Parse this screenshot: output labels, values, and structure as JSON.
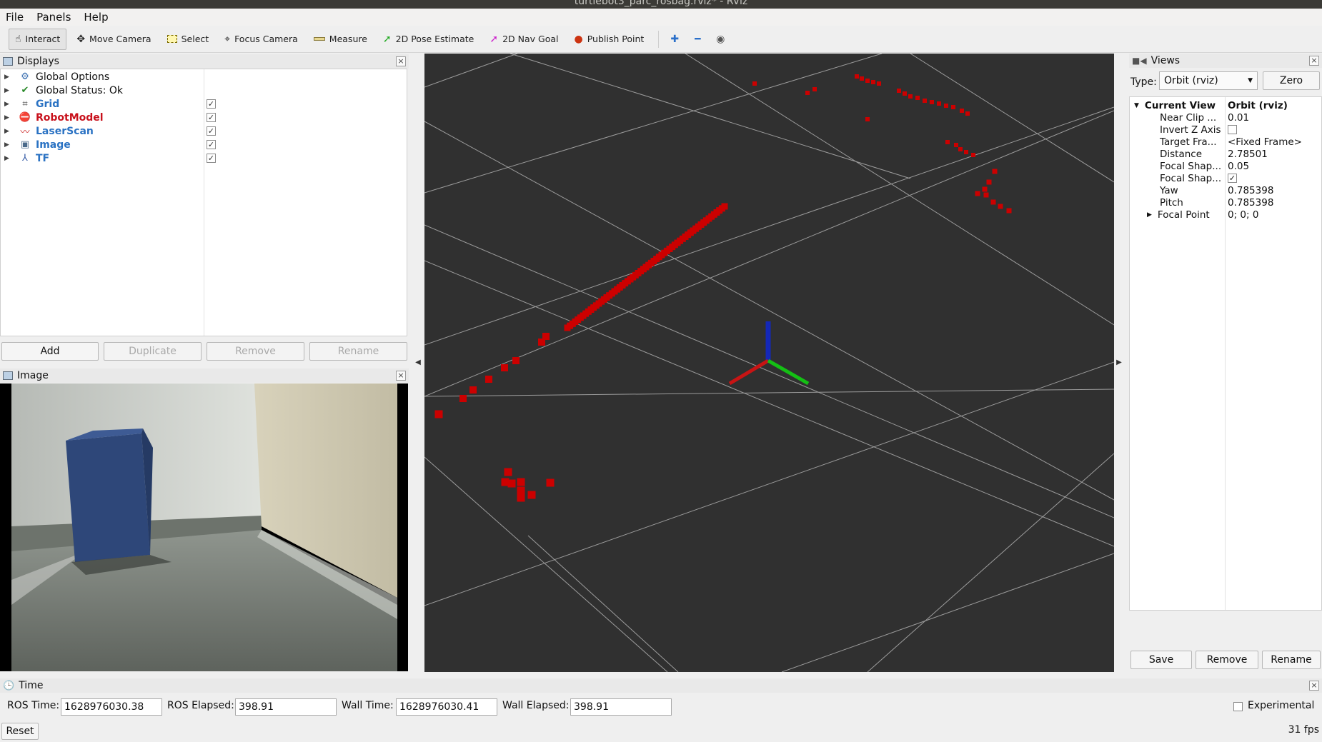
{
  "window": {
    "title": "turtlebot3_parc_rosbag.rviz* - RViz"
  },
  "menu": [
    "File",
    "Panels",
    "Help"
  ],
  "toolbar": {
    "interact": "Interact",
    "move_camera": "Move Camera",
    "select": "Select",
    "focus_camera": "Focus Camera",
    "measure": "Measure",
    "pose_estimate": "2D Pose Estimate",
    "nav_goal": "2D Nav Goal",
    "publish_point": "Publish Point"
  },
  "displays": {
    "title": "Displays",
    "items": [
      {
        "label": "Global Options",
        "icon": "gear-icon",
        "style": "normal",
        "checked": null
      },
      {
        "label": "Global Status: Ok",
        "icon": "check-icon",
        "style": "normal",
        "checked": null
      },
      {
        "label": "Grid",
        "icon": "grid-icon",
        "style": "blue",
        "checked": true
      },
      {
        "label": "RobotModel",
        "icon": "error-icon",
        "style": "red",
        "checked": true
      },
      {
        "label": "LaserScan",
        "icon": "laser-icon",
        "style": "blue",
        "checked": true
      },
      {
        "label": "Image",
        "icon": "image-icon",
        "style": "blue",
        "checked": true
      },
      {
        "label": "TF",
        "icon": "axes-icon",
        "style": "blue",
        "checked": true
      }
    ],
    "buttons": {
      "add": "Add",
      "duplicate": "Duplicate",
      "remove": "Remove",
      "rename": "Rename"
    }
  },
  "image_panel": {
    "title": "Image"
  },
  "views": {
    "title": "Views",
    "type_label": "Type:",
    "type_value": "Orbit (rviz)",
    "zero": "Zero",
    "header": {
      "name": "Current View",
      "value": "Orbit (rviz)"
    },
    "properties": [
      {
        "name": "Near Clip ...",
        "value": "0.01"
      },
      {
        "name": "Invert Z Axis",
        "value": "",
        "checkbox": false
      },
      {
        "name": "Target Fra...",
        "value": "<Fixed Frame>"
      },
      {
        "name": "Distance",
        "value": "2.78501"
      },
      {
        "name": "Focal Shap...",
        "value": "0.05"
      },
      {
        "name": "Focal Shap...",
        "value": "",
        "checkbox": true
      },
      {
        "name": "Yaw",
        "value": "0.785398"
      },
      {
        "name": "Pitch",
        "value": "0.785398"
      },
      {
        "name": "Focal Point",
        "value": "0; 0; 0"
      }
    ],
    "buttons": {
      "save": "Save",
      "remove": "Remove",
      "rename": "Rename"
    }
  },
  "time": {
    "title": "Time",
    "ros_time_label": "ROS Time:",
    "ros_time": "1628976030.38",
    "ros_elapsed_label": "ROS Elapsed:",
    "ros_elapsed": "398.91",
    "wall_time_label": "Wall Time:",
    "wall_time": "1628976030.41",
    "wall_elapsed_label": "Wall Elapsed:",
    "wall_elapsed": "398.91",
    "experimental": "Experimental",
    "reset": "Reset",
    "fps": "31 fps"
  },
  "colors": {
    "laser": "#cc0000",
    "grid": "#a0a0a0",
    "background": "#303030",
    "x_axis": "#cc1111",
    "y_axis": "#11bb11",
    "z_axis": "#1122bb"
  }
}
